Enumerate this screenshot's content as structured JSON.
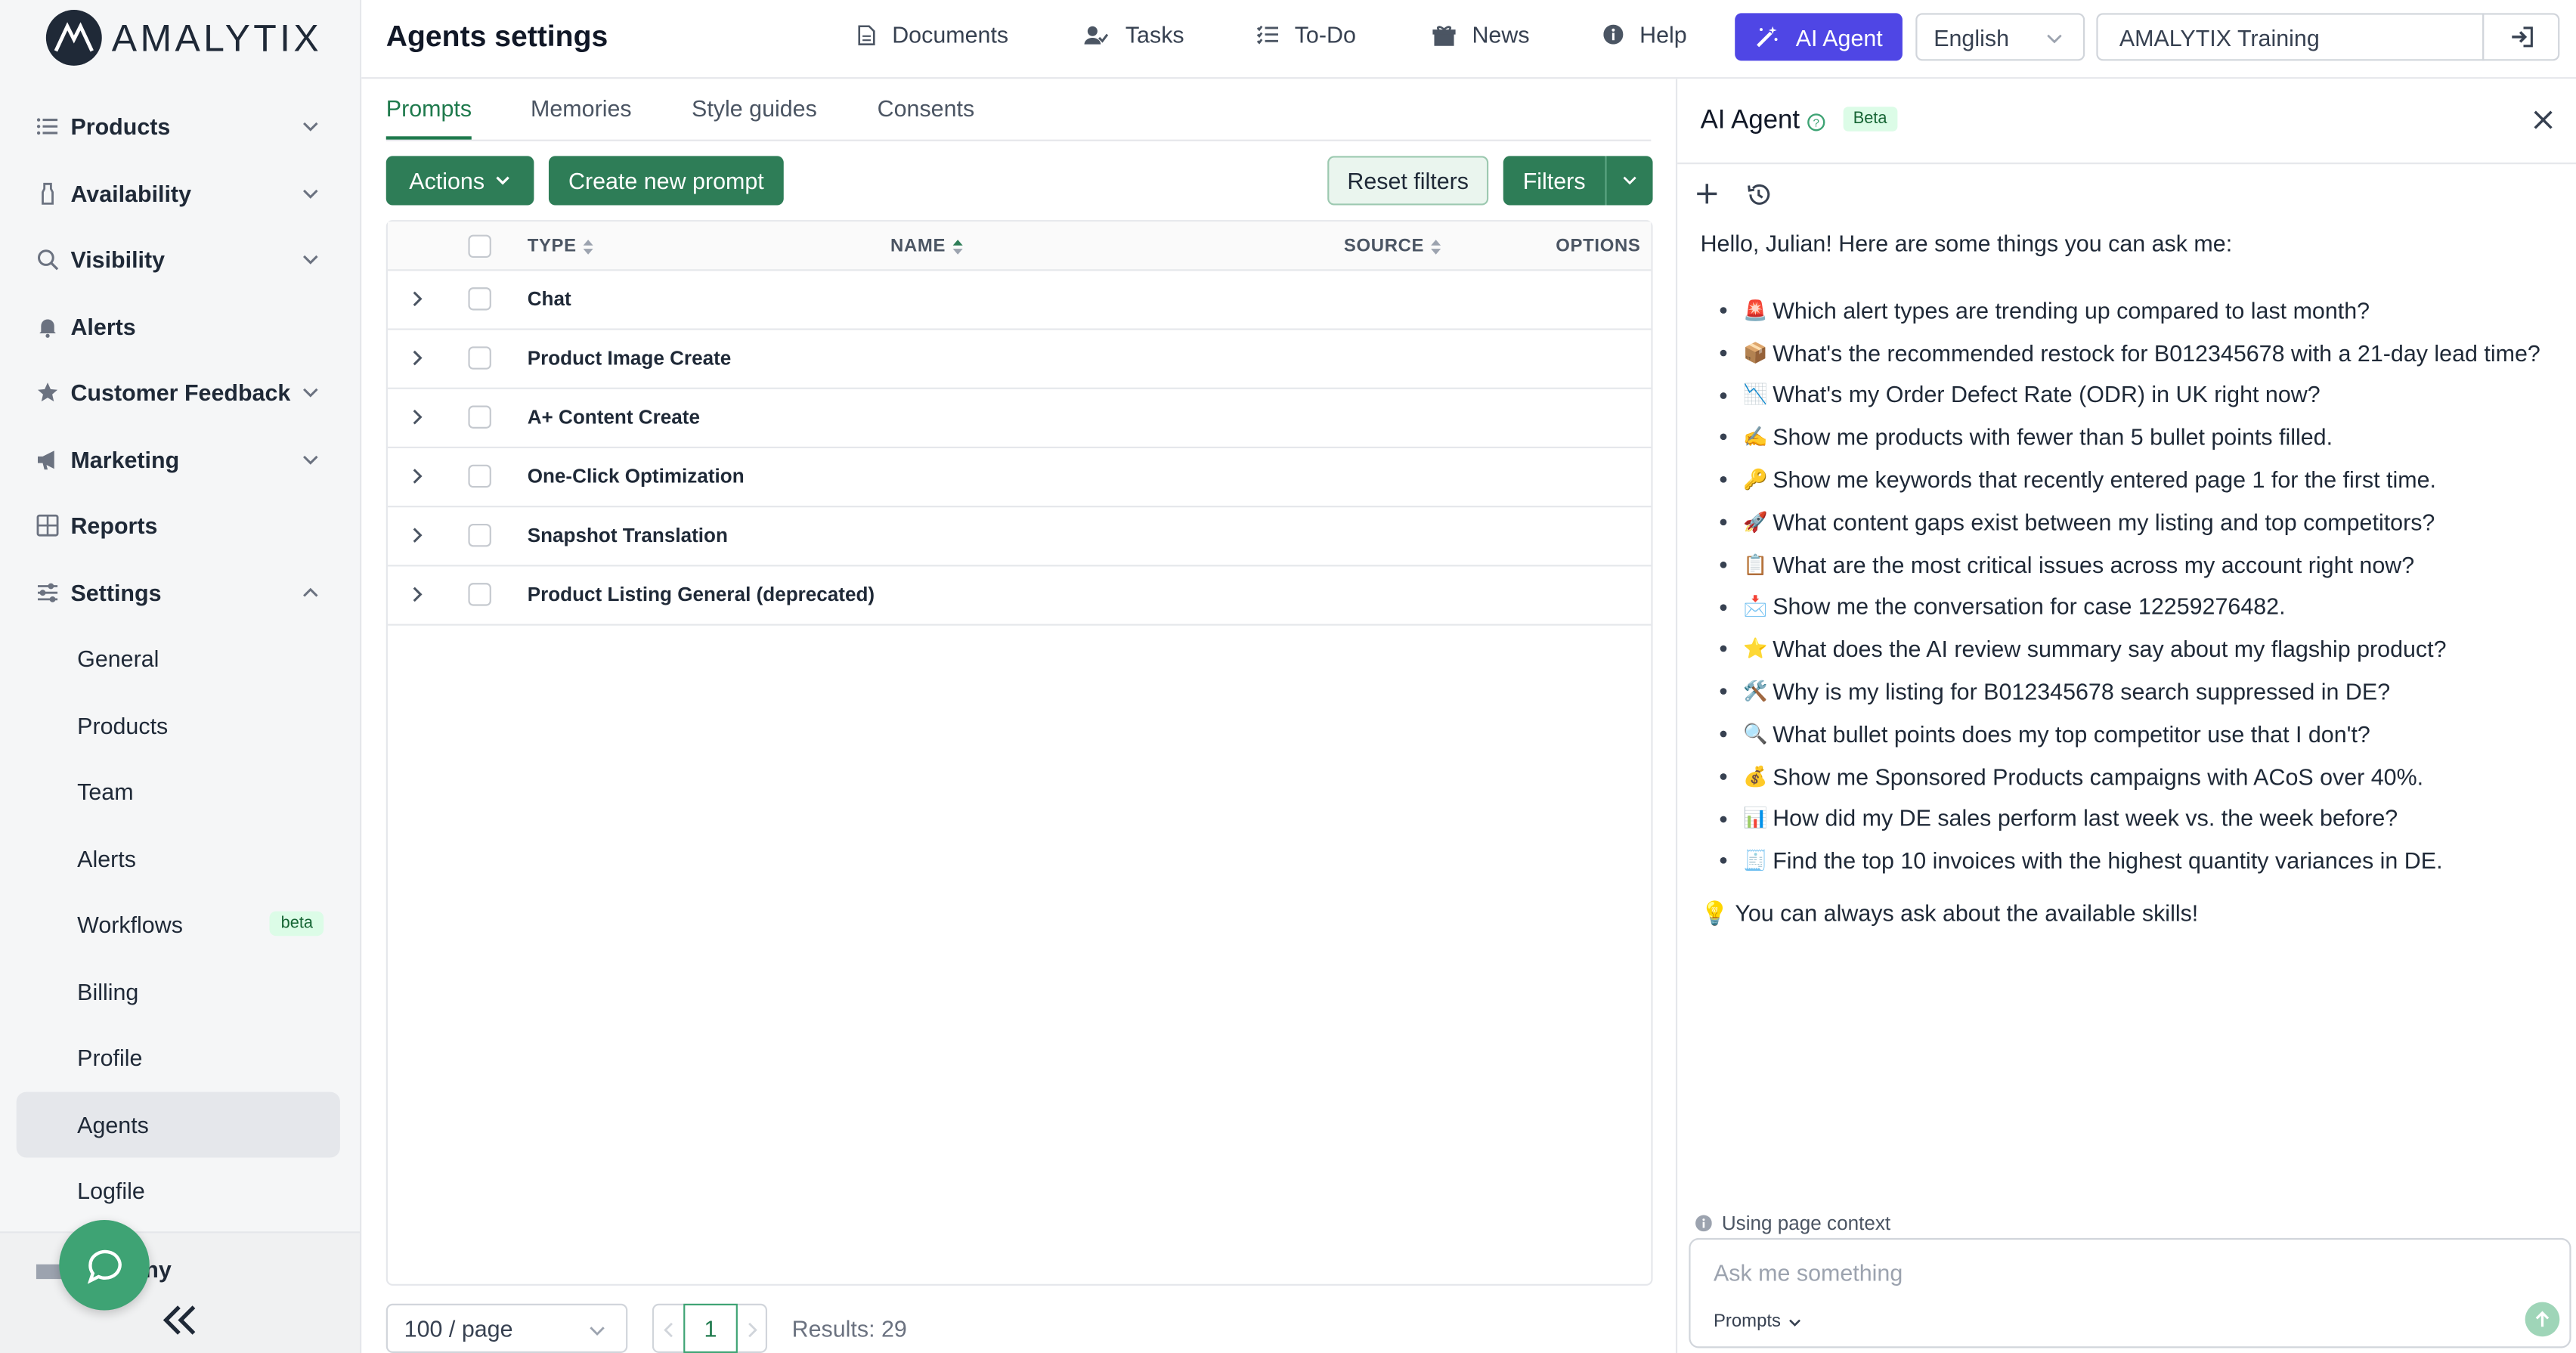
{
  "brand": {
    "logo_text": "AMALYTIX"
  },
  "sidebar": {
    "items": [
      {
        "label": "Products",
        "icon": "list-icon",
        "expandable": true
      },
      {
        "label": "Availability",
        "icon": "bottle-icon",
        "expandable": true
      },
      {
        "label": "Visibility",
        "icon": "search-icon",
        "expandable": true
      },
      {
        "label": "Alerts",
        "icon": "bell-icon",
        "expandable": false
      },
      {
        "label": "Customer Feedback",
        "icon": "star-icon",
        "expandable": true
      },
      {
        "label": "Marketing",
        "icon": "megaphone-icon",
        "expandable": true
      },
      {
        "label": "Reports",
        "icon": "grid-icon",
        "expandable": false
      },
      {
        "label": "Settings",
        "icon": "sliders-icon",
        "expandable": true,
        "expanded": true
      }
    ],
    "settings_sub": [
      {
        "label": "General"
      },
      {
        "label": "Products"
      },
      {
        "label": "Team"
      },
      {
        "label": "Alerts"
      },
      {
        "label": "Workflows",
        "badge": "beta"
      },
      {
        "label": "Billing"
      },
      {
        "label": "Profile"
      },
      {
        "label": "Agents",
        "active": true
      },
      {
        "label": "Logfile"
      }
    ],
    "footer_partial_label": "ny"
  },
  "header": {
    "title": "Agents settings",
    "links": [
      "Documents",
      "Tasks",
      "To-Do",
      "News",
      "Help"
    ],
    "ai_button": "AI Agent",
    "language": "English",
    "account": "AMALYTIX Training"
  },
  "main": {
    "tabs": [
      "Prompts",
      "Memories",
      "Style guides",
      "Consents"
    ],
    "active_tab": "Prompts",
    "actions_label": "Actions",
    "create_label": "Create new prompt",
    "reset_label": "Reset filters",
    "filters_label": "Filters",
    "columns": [
      "TYPE",
      "NAME",
      "SOURCE",
      "OPTIONS"
    ],
    "rows": [
      "Chat",
      "Product Image Create",
      "A+ Content Create",
      "One-Click Optimization",
      "Snapshot Translation",
      "Product Listing General (deprecated)"
    ],
    "pagination": {
      "per_page": "100 / page",
      "current_page": "1",
      "results": "Results: 29"
    }
  },
  "ai_panel": {
    "title": "AI Agent",
    "beta": "Beta",
    "greeting": "Hello, Julian! Here are some things you can ask me:",
    "suggestions": [
      {
        "emoji": "🚨",
        "text": "Which alert types are trending up compared to last month?"
      },
      {
        "emoji": "📦",
        "text": "What's the recommended restock for B012345678 with a 21-day lead time?"
      },
      {
        "emoji": "📉",
        "text": "What's my Order Defect Rate (ODR) in UK right now?"
      },
      {
        "emoji": "✍️",
        "text": "Show me products with fewer than 5 bullet points filled."
      },
      {
        "emoji": "🔑",
        "text": "Show me keywords that recently entered page 1 for the first time."
      },
      {
        "emoji": "🚀",
        "text": "What content gaps exist between my listing and top competitors?"
      },
      {
        "emoji": "📋",
        "text": "What are the most critical issues across my account right now?"
      },
      {
        "emoji": "📩",
        "text": "Show me the conversation for case 12259276482."
      },
      {
        "emoji": "⭐",
        "text": "What does the AI review summary say about my flagship product?"
      },
      {
        "emoji": "🛠️",
        "text": "Why is my listing for B012345678 search suppressed in DE?"
      },
      {
        "emoji": "🔍",
        "text": "What bullet points does my top competitor use that I don't?"
      },
      {
        "emoji": "💰",
        "text": "Show me Sponsored Products campaigns with ACoS over 40%."
      },
      {
        "emoji": "📊",
        "text": "How did my DE sales perform last week vs. the week before?"
      },
      {
        "emoji": "🧾",
        "text": "Find the top 10 invoices with the highest quantity variances in DE."
      }
    ],
    "tip": "💡 You can always ask about the available skills!",
    "context_label": "Using page context",
    "input_placeholder": "Ask me something",
    "prompts_label": "Prompts"
  },
  "colors": {
    "accent_green": "#2e7d57",
    "ai_purple": "#4f46e5"
  }
}
